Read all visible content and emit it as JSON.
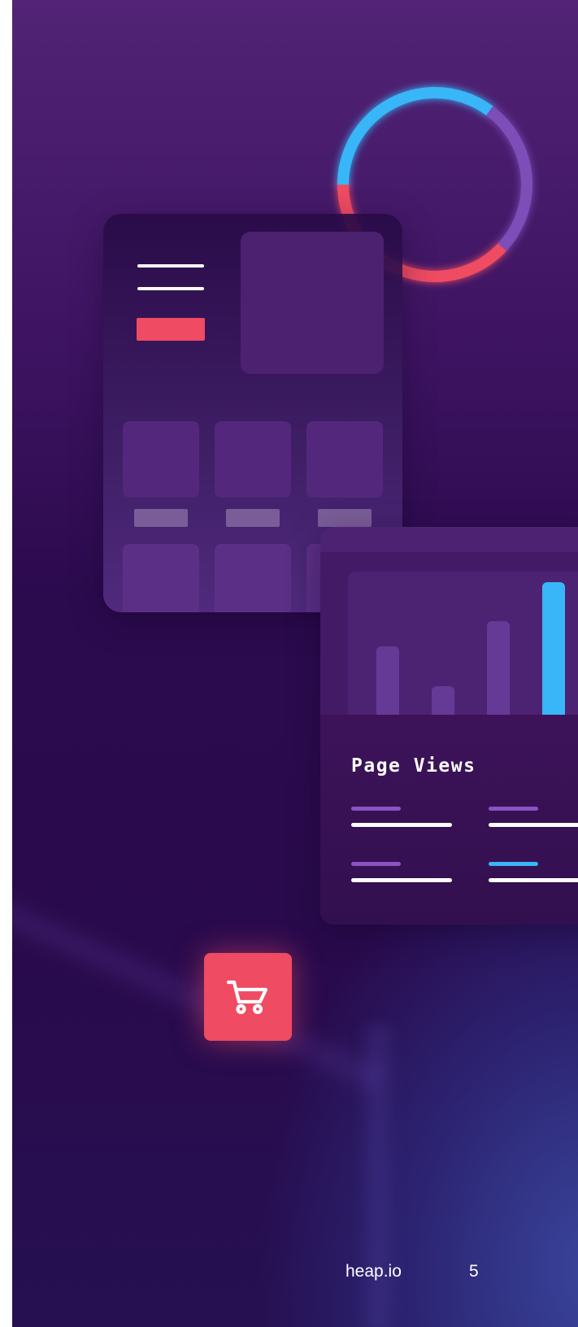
{
  "colors": {
    "accent_red": "#ef4b62",
    "accent_blue": "#38b6f8",
    "accent_purple": "#8a52c4",
    "background_dark": "#290a4c"
  },
  "illustration": {
    "ring_icon": "donut-ring-icon",
    "cart_icon": "shopping-cart-icon"
  },
  "analytics_card": {
    "title": "Page Views"
  },
  "footer": {
    "site": "heap.io",
    "page_number": "5"
  }
}
